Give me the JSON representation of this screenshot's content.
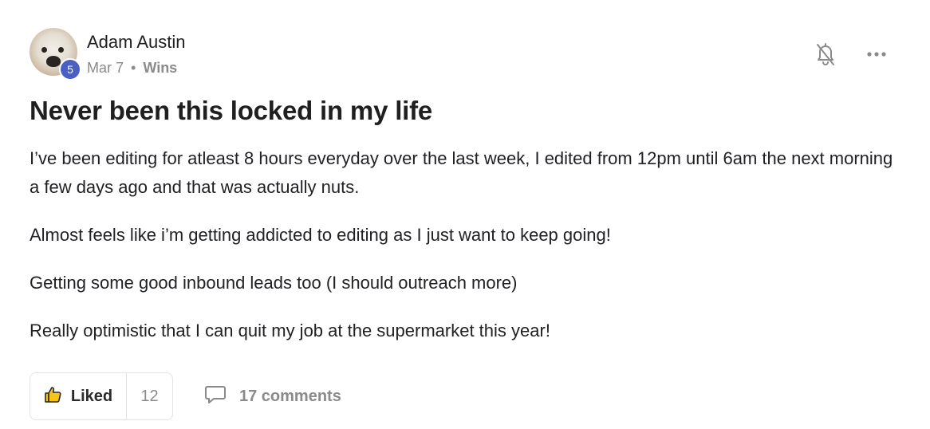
{
  "post": {
    "author": "Adam Austin",
    "level": "5",
    "date": "Mar 7",
    "separator": "•",
    "category": "Wins",
    "title": "Never been this locked in my life",
    "paragraphs": [
      "I’ve been editing for atleast 8 hours everyday over the last week, I edited from 12pm until 6am the next morning a few days ago and that was actually nuts.",
      "Almost feels like i’m getting addicted to editing as I just want to keep going!",
      "Getting some good inbound leads too (I should outreach more)",
      "Really optimistic that I can quit my job at the supermarket this year!"
    ]
  },
  "actions": {
    "notify_icon": "bell-off-icon",
    "more_icon": "more-horizontal-icon"
  },
  "footer": {
    "like_label": "Liked",
    "like_count": "12",
    "like_icon": "thumbs-up-icon",
    "like_icon_color": "#f5c518",
    "comments_label": "17 comments",
    "comments_icon": "comment-icon"
  },
  "colors": {
    "level_badge": "#4a5fc1",
    "muted_text": "#8a8a8a"
  }
}
